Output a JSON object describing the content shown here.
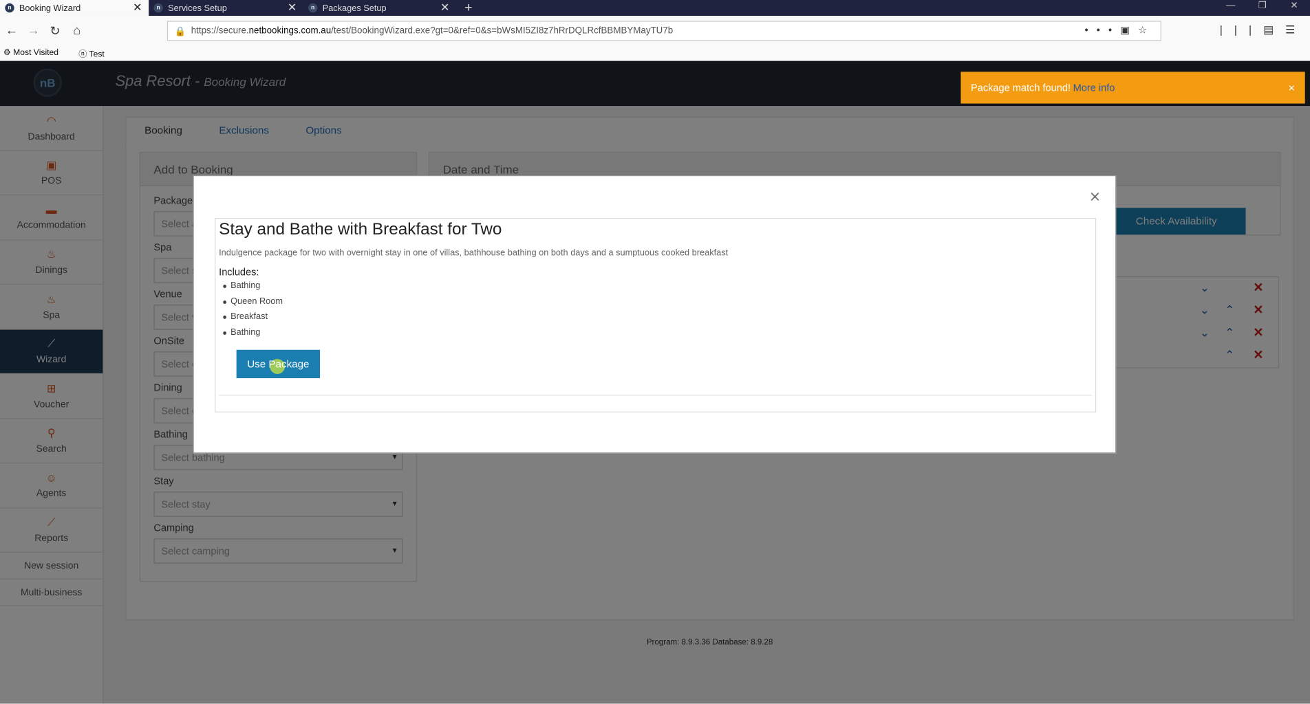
{
  "browser": {
    "tabs": [
      {
        "title": "Booking Wizard",
        "active": true
      },
      {
        "title": "Services Setup",
        "active": false
      },
      {
        "title": "Packages Setup",
        "active": false
      }
    ],
    "new_tab": "+",
    "url_prefix": "https://secure.",
    "url_domain": "netbookings.com.au",
    "url_path": "/test/BookingWizard.exe?gt=0&ref=0&s=bWsMI5ZI8z7hRrDQLRcfBBMBYMayTU7b",
    "bookmarks": [
      "Most Visited",
      "Test"
    ]
  },
  "app": {
    "logo": "nB",
    "title": "Spa Resort",
    "subtitle": "Booking Wizard"
  },
  "toast": {
    "message": "Package match found!",
    "link": "More info",
    "close": "×"
  },
  "sidebar": {
    "items": [
      {
        "label": "Dashboard",
        "icon": "dashboard-icon"
      },
      {
        "label": "POS",
        "icon": "pos-icon"
      },
      {
        "label": "Accommodation",
        "icon": "bed-icon"
      },
      {
        "label": "Dinings",
        "icon": "dining-icon"
      },
      {
        "label": "Spa",
        "icon": "spa-icon"
      },
      {
        "label": "Wizard",
        "icon": "wand-icon",
        "active": true
      },
      {
        "label": "Voucher",
        "icon": "gift-icon"
      },
      {
        "label": "Search",
        "icon": "search-icon"
      },
      {
        "label": "Agents",
        "icon": "agent-icon"
      },
      {
        "label": "Reports",
        "icon": "chart-icon"
      }
    ],
    "new_session": "New session",
    "multi_business": "Multi-business"
  },
  "main": {
    "tabs": [
      "Booking",
      "Exclusions",
      "Options"
    ],
    "add_to_booking": "Add to Booking",
    "date_and_time": "Date and Time",
    "check_availability": "Check Availability",
    "fields": [
      {
        "label": "Package",
        "placeholder": "Select a"
      },
      {
        "label": "Spa",
        "placeholder": "Select s"
      },
      {
        "label": "Venue",
        "placeholder": "Select v"
      },
      {
        "label": "OnSite",
        "placeholder": "Select o"
      },
      {
        "label": "Dining",
        "placeholder": "Select d"
      },
      {
        "label": "Bathing",
        "placeholder": "Select bathing"
      },
      {
        "label": "Stay",
        "placeholder": "Select stay"
      },
      {
        "label": "Camping",
        "placeholder": "Select camping"
      }
    ],
    "version": "Program: 8.9.3.36 Database: 8.9.28"
  },
  "modal": {
    "close": "×",
    "title": "Stay and Bathe with Breakfast for Two",
    "description": "Indulgence package for two with overnight stay in one of villas, bathhouse bathing on both days and a sumptuous cooked breakfast",
    "includes_label": "Includes:",
    "includes": [
      "Bathing",
      "Queen Room",
      "Breakfast",
      "Bathing"
    ],
    "use_button": "Use Package"
  },
  "colors": {
    "accent": "#1b7eb0",
    "toast": "#f39c12",
    "header": "#212730",
    "sidebar_active": "#1f3a57",
    "delete": "#cc1f1f"
  }
}
